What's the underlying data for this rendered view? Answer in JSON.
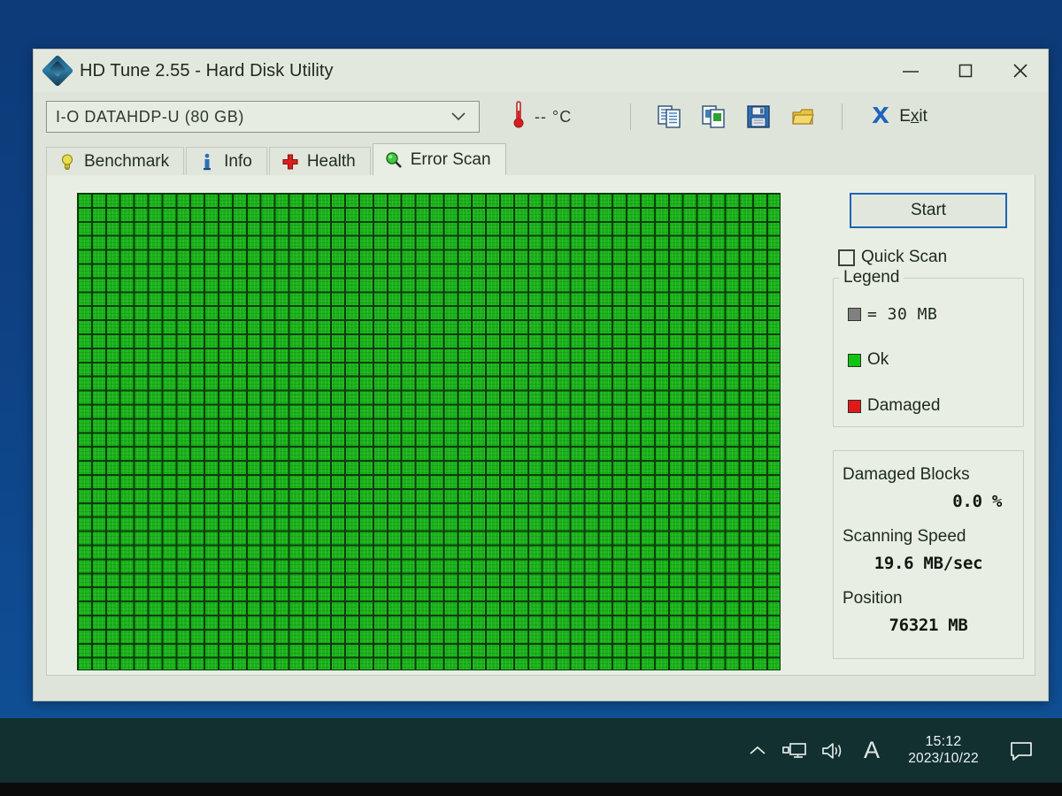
{
  "window": {
    "title": "HD Tune 2.55 - Hard Disk Utility",
    "app_icon": "hdtune-diamond-icon",
    "controls": {
      "minimize": "minimize-icon",
      "maximize": "maximize-icon",
      "close": "close-icon"
    }
  },
  "toolbar": {
    "drive_selected": "I-O DATAHDP-U (80 GB)",
    "drive_options": [
      "I-O DATAHDP-U (80 GB)"
    ],
    "temperature": "-- °C",
    "temperature_icon": "thermometer-icon",
    "buttons": [
      {
        "name": "copy-icon",
        "label": "Copy"
      },
      {
        "name": "copy-screenshot-icon",
        "label": "Copy Screenshot"
      },
      {
        "name": "save-icon",
        "label": "Save"
      },
      {
        "name": "folder-icon",
        "label": "Open"
      }
    ],
    "exit_label": "Exit",
    "exit_icon": "exit-x-icon"
  },
  "tabs": [
    {
      "label": "Benchmark",
      "icon": "lightbulb-icon",
      "active": false
    },
    {
      "label": "Info",
      "icon": "info-icon",
      "active": false
    },
    {
      "label": "Health",
      "icon": "red-cross-icon",
      "active": false
    },
    {
      "label": "Error Scan",
      "icon": "magnifier-icon",
      "active": true
    }
  ],
  "panel": {
    "start_label": "Start",
    "quick_scan_label": "Quick Scan",
    "quick_scan_checked": false,
    "legend_title": "Legend",
    "legend": [
      {
        "swatch": "grey",
        "text": "= 30 MB"
      },
      {
        "swatch": "green",
        "text": "Ok"
      },
      {
        "swatch": "red",
        "text": "Damaged"
      }
    ],
    "stats": [
      {
        "label": "Damaged Blocks",
        "value": "0.0 %"
      },
      {
        "label": "Scanning Speed",
        "value": "19.6 MB/sec"
      },
      {
        "label": "Position",
        "value": "76321 MB"
      }
    ]
  },
  "blockmap": {
    "block_color_ok": "#12c412",
    "block_color_damaged": "#e01a1a",
    "grid_line_color": "#0a3d0a",
    "columns": 50,
    "rows": 34
  },
  "taskbar": {
    "chevron_icon": "chevron-up-icon",
    "network_icon": "network-icon",
    "volume_icon": "volume-icon",
    "ime_label": "A",
    "time": "15:12",
    "date": "2023/10/22",
    "notification_icon": "notification-icon"
  },
  "colors": {
    "desktop": "#0e4183",
    "window_bg": "#dfe4da",
    "accent_focus": "#1f64b5",
    "taskbar": "#11302f"
  }
}
